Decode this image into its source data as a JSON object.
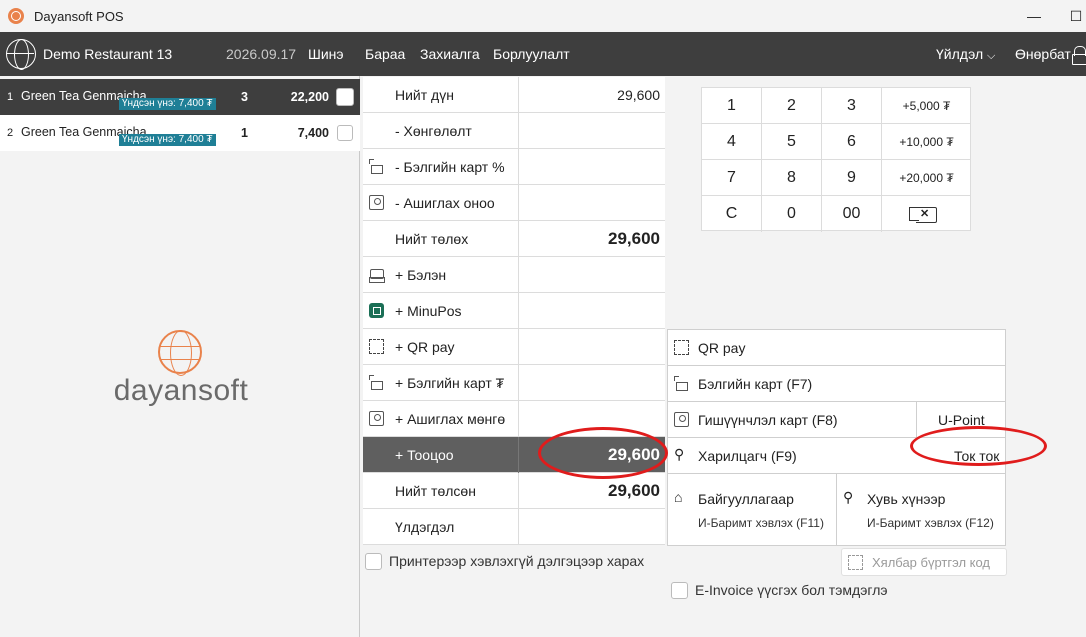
{
  "window": {
    "title": "Dayansoft POS"
  },
  "topnav": {
    "restaurant": "Demo Restaurant 13",
    "date": "2026.09.17",
    "items": [
      "Шинэ",
      "Бараа",
      "Захиалга",
      "Борлуулалт"
    ],
    "operation": "Үйлдэл",
    "user": "Өнөрбат"
  },
  "orders": [
    {
      "index": "1",
      "name": "Green Tea Genmaicha",
      "base_price": "Үндсэн үнэ: 7,400 ₮",
      "qty": "3",
      "total": "22,200",
      "selected": true
    },
    {
      "index": "2",
      "name": "Green Tea Genmaicha",
      "base_price": "Үндсэн үнэ: 7,400 ₮",
      "qty": "1",
      "total": "7,400",
      "selected": false
    }
  ],
  "logo": {
    "word": "dayansoft"
  },
  "payment": {
    "rows": [
      {
        "label": "Нийт дүн",
        "value": "29,600",
        "icon": "",
        "big": false
      },
      {
        "label": "- Хөнгөлөлт",
        "value": "",
        "icon": ""
      },
      {
        "label": "- Бэлгийн карт %",
        "value": "",
        "icon": "gift-icon"
      },
      {
        "label": "- Ашиглах оноо",
        "value": "",
        "icon": "user-card-icon"
      },
      {
        "label": "Нийт төлөх",
        "value": "29,600",
        "icon": "",
        "big": true
      },
      {
        "label": "+ Бэлэн",
        "value": "",
        "icon": "cash-register-icon"
      },
      {
        "label": "+ MinuPos",
        "value": "",
        "icon": "minupos-icon"
      },
      {
        "label": "+ QR pay",
        "value": "",
        "icon": "qr-icon"
      },
      {
        "label": "+ Бэлгийн карт ₮",
        "value": "",
        "icon": "gift-icon"
      },
      {
        "label": "+ Ашиглах мөнгө",
        "value": "",
        "icon": "user-card-icon"
      },
      {
        "label": "+ Тооцоо",
        "value": "29,600",
        "icon": "",
        "big": true,
        "active": true
      },
      {
        "label": "Нийт төлсөн",
        "value": "29,600",
        "icon": "",
        "big": true
      },
      {
        "label": "Үлдэгдэл",
        "value": "",
        "icon": ""
      }
    ]
  },
  "keypad": {
    "keys": [
      "1",
      "2",
      "3",
      "+5,000 ₮",
      "4",
      "5",
      "6",
      "+10,000 ₮",
      "7",
      "8",
      "9",
      "+20,000 ₮",
      "C",
      "0",
      "00",
      ""
    ]
  },
  "methods": {
    "qr": "QR pay",
    "gift": "Бэлгийн карт (F7)",
    "member": "Гишүүнчлэл карт (F8)",
    "upoint": "U-Point",
    "customer": "Харилцагч (F9)",
    "customer_name": "Ток ток",
    "org": "Байгууллагаар",
    "org_sub": "И-Баримт хэвлэх (F11)",
    "person": "Хувь хүнээр",
    "person_sub": "И-Баримт хэвлэх (F12)"
  },
  "options": {
    "printer": "Принтерээр хэвлэхгүй дэлгэцээр харах",
    "easy_code": "Хялбар бүртгэл код",
    "einvoice": "E-Invoice үүсгэх бол тэмдэглэ"
  },
  "colors": {
    "nav": "#3e3e3e",
    "accent": "#e9824b",
    "badge": "#1f7f96",
    "annotation": "#e01c1c"
  }
}
